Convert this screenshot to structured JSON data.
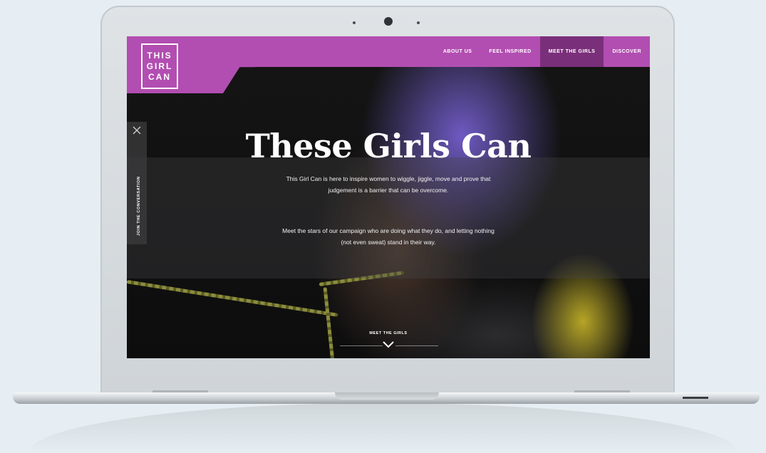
{
  "logo": {
    "lines": [
      "THIS",
      "GIRL",
      "CAN"
    ]
  },
  "nav": {
    "items": [
      {
        "label": "ABOUT US"
      },
      {
        "label": "FEEL INSPIRED"
      },
      {
        "label": "MEET THE GIRLS"
      },
      {
        "label": "DISCOVER"
      }
    ],
    "active_index": 2
  },
  "sidebar": {
    "label": "JOIN THE CONVERSATION"
  },
  "hero": {
    "title": "These Girls Can",
    "paragraph1": "This Girl Can is here to inspire women to wiggle, jiggle, move and prove that judgement is a barrier that can be overcome.",
    "paragraph2": "Meet the stars of our campaign who are doing what they do, and letting nothing (not even sweat) stand in their way."
  },
  "cta": {
    "label": "MEET THE GIRLS"
  },
  "colors": {
    "brand": "#b24eb1",
    "nav_active": "#7a2f7a"
  }
}
